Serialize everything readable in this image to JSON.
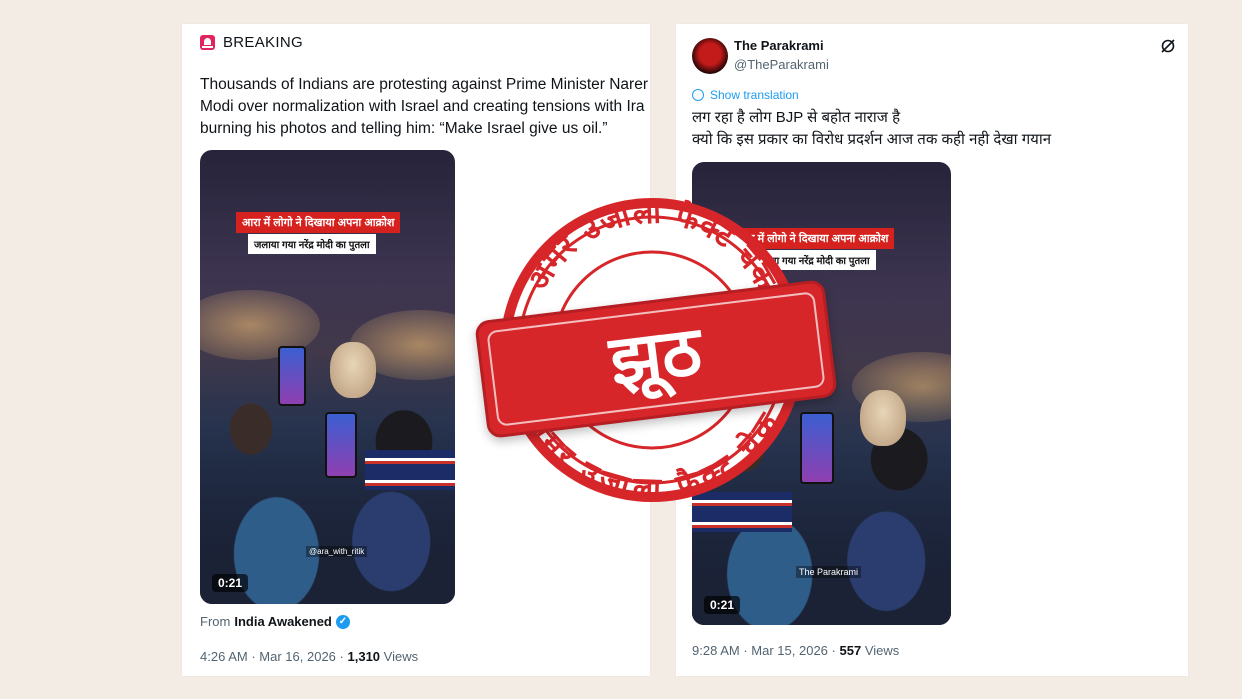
{
  "left_tweet": {
    "label": "BREAKING",
    "text_lines": [
      "Thousands of Indians are protesting against Prime Minister Narer",
      "Modi over normalization with Israel and creating tensions with Ira",
      "burning his photos and telling him: “Make Israel give us oil.”"
    ],
    "video": {
      "banner_line1": "आरा में लोगो ने दिखाया अपना आक्रोश",
      "banner_line2": "जलाया गया नरेंद्र मोदी का पुतला",
      "watermark": "@ara_with_ritik",
      "duration": "0:21"
    },
    "from_prefix": "From",
    "from_name": "India Awakened",
    "time": "4:26 AM",
    "date": "Mar 16, 2026",
    "separator": "·",
    "views_count": "1,310",
    "views_label": "Views"
  },
  "right_tweet": {
    "author_name": "The Parakrami",
    "author_handle": "@TheParakrami",
    "show_translation": "Show translation",
    "text_lines": [
      "लग रहा है लोग BJP से बहोत नाराज है",
      "क्यो कि इस प्रकार का विरोध प्रदर्शन आज तक कही नही देखा गयान"
    ],
    "video": {
      "banner_line1": "आरा में लोगो ने दिखाया अपना आक्रोश",
      "banner_line2": "जलाया गया नरेंद्र मोदी का पुतला",
      "watermark": "The Parakrami",
      "duration": "0:21"
    },
    "time": "9:28 AM",
    "date": "Mar 15, 2026",
    "separator": "·",
    "views_count": "557",
    "views_label": "Views"
  },
  "stamp": {
    "top_arc": "अमर उजाला फैक्ट चेक",
    "bottom_arc": "अमर उजाला फैक्ट चेक",
    "verdict": "झूठ",
    "color": "#d7262a"
  }
}
